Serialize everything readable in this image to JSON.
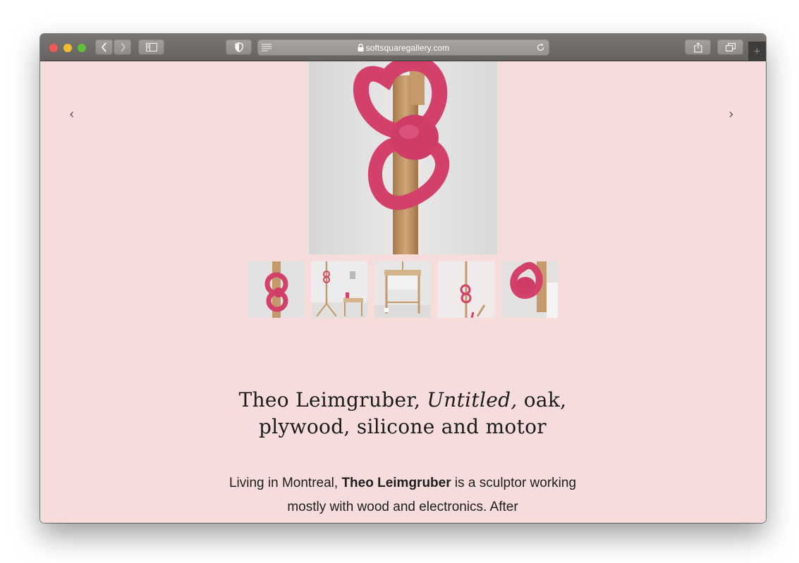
{
  "browser": {
    "url": "softsquaregallery.com",
    "new_tab_symbol": "+"
  },
  "gallery": {
    "prev_symbol": "‹",
    "next_symbol": "›",
    "thumbnail_count": 5
  },
  "artwork": {
    "artist": "Theo Leimgruber",
    "title_sep": ", ",
    "title": "Untitled,",
    "materials_line1": " oak,",
    "materials_line2": "plywood, silicone and motor"
  },
  "description": {
    "intro": "Living in Montreal, ",
    "artist_bold": "Theo Leimgruber",
    "rest": " is a sculptor working mostly with wood and electronics. After"
  },
  "colors": {
    "page_background": "#f6dddb",
    "sculpture_pink": "#d9456e",
    "wood": "#c49a6c"
  }
}
